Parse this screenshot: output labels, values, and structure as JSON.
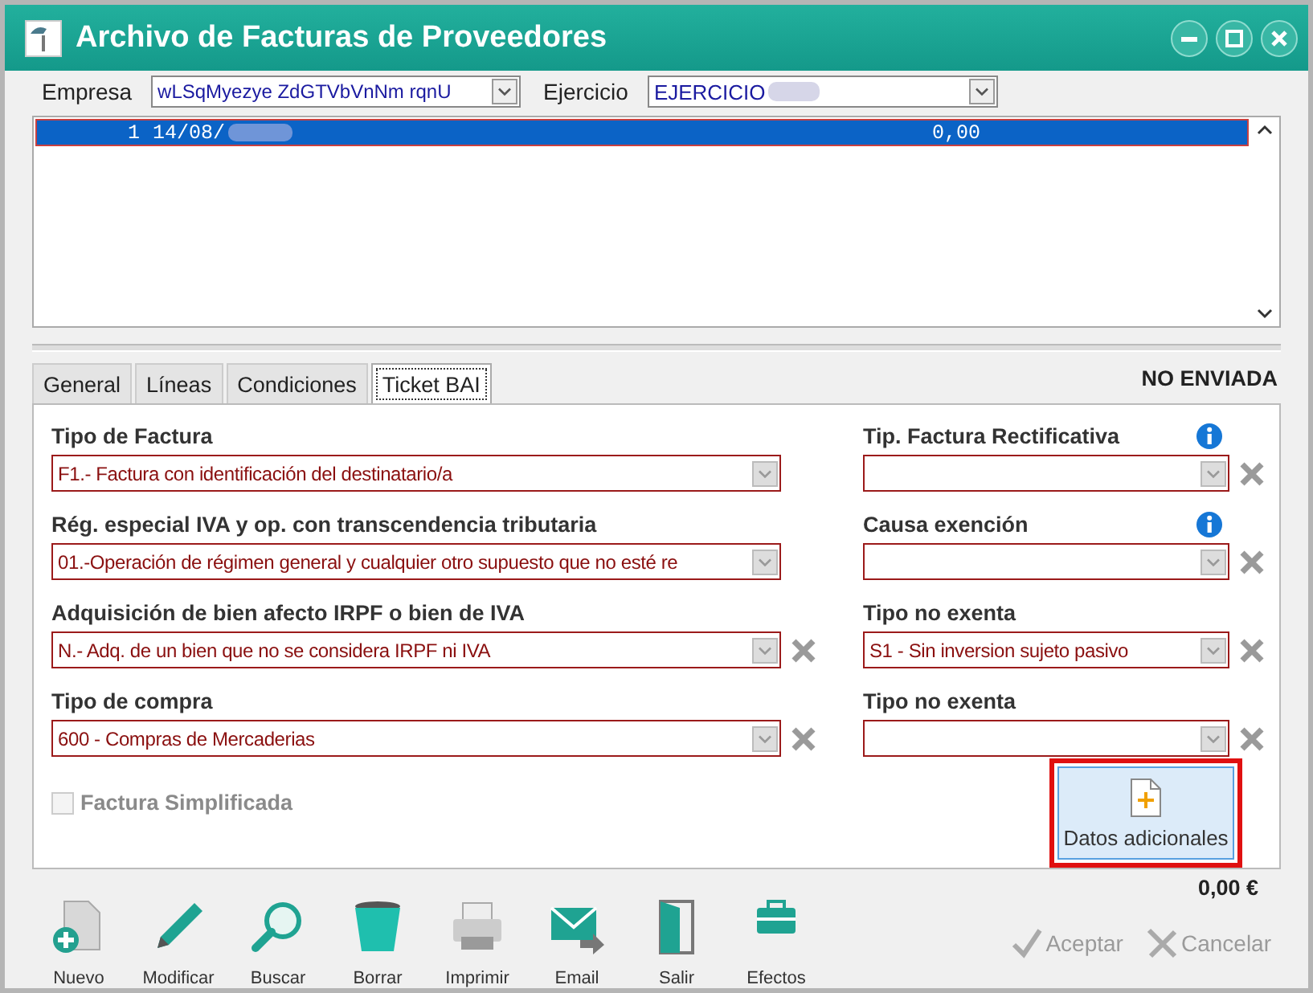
{
  "window": {
    "title": "Archivo de Facturas de Proveedores"
  },
  "header": {
    "empresa_label": "Empresa",
    "empresa_value": "wLSqMyezye ZdGTVbVnNm rqnU",
    "ejercicio_label": "Ejercicio",
    "ejercicio_value": "EJERCICIO"
  },
  "list_rows": [
    {
      "number": "1",
      "date": "14/08/",
      "amount": "0,00",
      "selected": true
    }
  ],
  "tabs": [
    {
      "label": "General",
      "selected": false
    },
    {
      "label": "Líneas",
      "selected": false
    },
    {
      "label": "Condiciones",
      "selected": false
    },
    {
      "label": "Ticket BAI",
      "selected": true
    }
  ],
  "status": "NO ENVIADA",
  "fields": [
    {
      "label": "Tipo de Factura",
      "value": "F1.- Factura con identificación del destinatario/a",
      "clear": false,
      "info": false
    },
    {
      "label": "Tip. Factura Rectificativa",
      "info": true,
      "clear": true
    },
    {
      "label": "Rég. especial IVA y op. con transcendencia tributaria",
      "value": "01.-Operación de régimen general y cualquier otro supuesto que no esté re",
      "clear": false,
      "info": false
    },
    {
      "label": "Causa exención",
      "info": true,
      "clear": true
    },
    {
      "label": "Adquisición de bien afecto IRPF o bien de IVA",
      "value": "N.- Adq. de un bien que no se considera IRPF ni IVA",
      "clear": true,
      "info": false
    },
    {
      "label": "Tipo no exenta",
      "value": "S1 - Sin inversion sujeto pasivo",
      "clear": true,
      "info": false
    },
    {
      "label": "Tipo de compra",
      "value": "600 - Compras de Mercaderias",
      "clear": true,
      "info": false
    },
    {
      "label": "Tipo no exenta",
      "clear": true,
      "info": false
    }
  ],
  "checkbox": {
    "label": "Factura Simplificada",
    "checked": false,
    "disabled": true
  },
  "extra_button": {
    "label": "Datos adicionales",
    "highlighted": true
  },
  "total": "0,00 €",
  "toolbar": [
    {
      "label": "Nuevo",
      "kind": "new"
    },
    {
      "label": "Modificar",
      "kind": "pen"
    },
    {
      "label": "Buscar",
      "kind": "search"
    },
    {
      "label": "Borrar",
      "kind": "bin"
    },
    {
      "label": "Imprimir",
      "kind": "printer"
    },
    {
      "label": "Email",
      "kind": "mail"
    },
    {
      "label": "Salir",
      "kind": "door"
    },
    {
      "label": "Efectos",
      "kind": "briefcase"
    }
  ],
  "actions": [
    {
      "label": "Aceptar",
      "kind": "accept",
      "disabled": true
    },
    {
      "label": "Cancelar",
      "kind": "cancel",
      "disabled": true
    }
  ]
}
